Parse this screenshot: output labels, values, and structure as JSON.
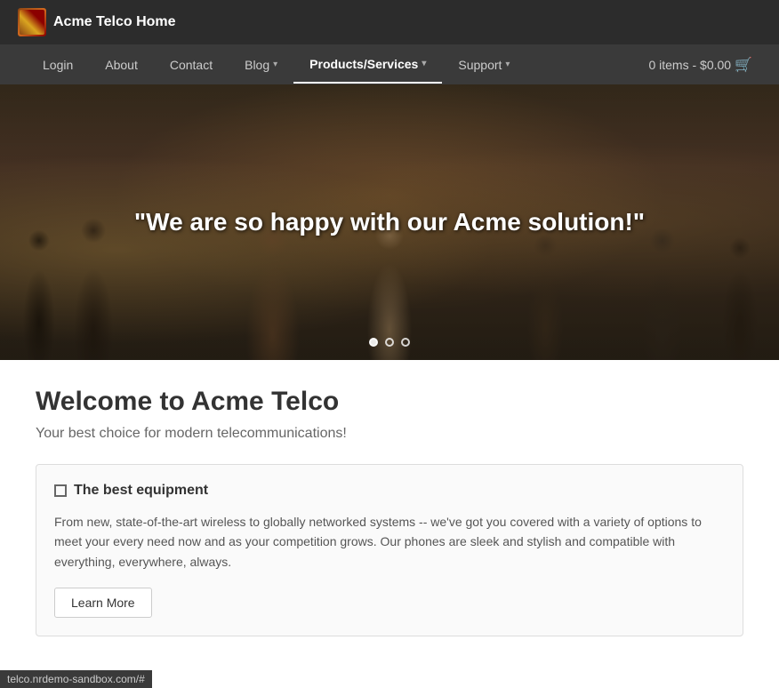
{
  "brand": {
    "name": "Acme Telco Home"
  },
  "navbar": {
    "links": [
      {
        "label": "Login",
        "active": false,
        "dropdown": false
      },
      {
        "label": "About",
        "active": false,
        "dropdown": false
      },
      {
        "label": "Contact",
        "active": false,
        "dropdown": false
      },
      {
        "label": "Blog",
        "active": false,
        "dropdown": true
      },
      {
        "label": "Products/Services",
        "active": true,
        "dropdown": true
      },
      {
        "label": "Support",
        "active": false,
        "dropdown": true
      }
    ],
    "cart": {
      "label": "0 items - $0.00"
    }
  },
  "hero": {
    "quote": "\"We are so happy with our Acme solution!\"",
    "dots": [
      {
        "active": true
      },
      {
        "active": false
      },
      {
        "active": false
      }
    ]
  },
  "main": {
    "welcome_title": "Welcome to Acme Telco",
    "welcome_subtitle": "Your best choice for modern telecommunications!",
    "card": {
      "header": "The best equipment",
      "body": "From new, state-of-the-art wireless to globally networked systems -- we've got you covered with a variety of options to meet your every need now and as your competition grows. Our phones are sleek and stylish and compatible with everything, everywhere, always.",
      "button_label": "Learn More"
    }
  },
  "status_bar": {
    "url": "telco.nrdemo-sandbox.com/#"
  }
}
